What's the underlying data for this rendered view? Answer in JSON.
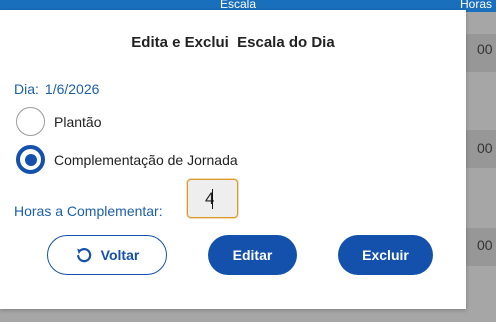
{
  "background": {
    "columns": [
      "Escala",
      "Horas"
    ],
    "row_fragments": [
      "00",
      "00",
      "00"
    ]
  },
  "dialog": {
    "title": "Edita e Exclui  Escala do Dia",
    "date_label": "Dia:",
    "date_value": "1/6/2026",
    "options": [
      {
        "label": "Plantão",
        "selected": false
      },
      {
        "label": "Complementação de Jornada",
        "selected": true
      }
    ],
    "hours_label": "Horas a Complementar:",
    "hours_value": "4",
    "buttons": {
      "back": "Voltar",
      "edit": "Editar",
      "delete": "Excluir"
    },
    "icons": {
      "back": "undo-arrow-icon"
    },
    "colors": {
      "primary": "#1351ad",
      "label_blue": "#1b5fab",
      "input_focus": "#d99a2b"
    }
  }
}
